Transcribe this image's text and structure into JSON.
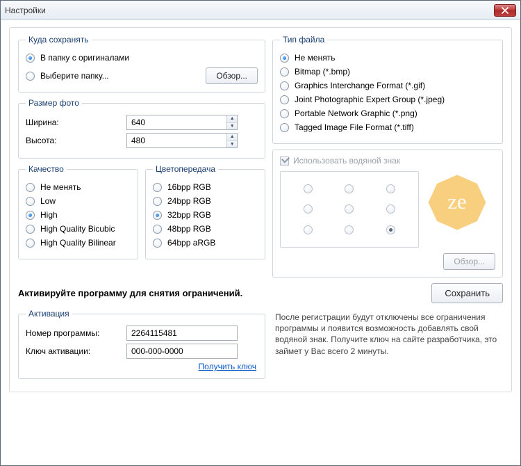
{
  "window": {
    "title": "Настройки"
  },
  "save_to": {
    "legend": "Куда сохранять",
    "opt_originals": "В папку с оригиналами",
    "opt_choose": "Выберите папку...",
    "selected": "originals",
    "browse": "Обзор..."
  },
  "size": {
    "legend": "Размер фото",
    "width_label": "Ширина:",
    "height_label": "Высота:",
    "width": "640",
    "height": "480"
  },
  "filetype": {
    "legend": "Тип файла",
    "selected": "keep",
    "keep": "Не менять",
    "bmp": "Bitmap (*.bmp)",
    "gif": "Graphics Interchange Format (*.gif)",
    "jpeg": "Joint Photographic Expert Group (*.jpeg)",
    "png": "Portable Network Graphic (*.png)",
    "tiff": "Tagged Image File Format (*.tiff)"
  },
  "quality": {
    "legend": "Качество",
    "selected": "high",
    "keep": "Не менять",
    "low": "Low",
    "high": "High",
    "hqbic": "High Quality Bicubic",
    "hqbil": "High Quality Bilinear"
  },
  "color": {
    "legend": "Цветопередача",
    "selected": "32",
    "b16": "16bpp RGB",
    "b24": "24bpp RGB",
    "b32": "32bpp RGB",
    "b48": "48bpp RGB",
    "b64": "64bpp aRGB"
  },
  "watermark": {
    "use_label": "Использовать водяной знак",
    "checked": true,
    "enabled": false,
    "browse": "Обзор...",
    "position_selected": 8
  },
  "activate_prompt": "Активируйте программу для снятия ограничений.",
  "save_button": "Сохранить",
  "activation": {
    "legend": "Активация",
    "program_no_label": "Номер программы:",
    "program_no": "2264115481",
    "key_label": "Ключ активации:",
    "key": "000-000-0000",
    "get_key": "Получить ключ",
    "info": "После регистрации будут отключены все ограничения программы и появится возможность добавлять свой водяной знак. Получите ключ на сайте разработчика, это займет у Вас всего 2 минуты."
  }
}
